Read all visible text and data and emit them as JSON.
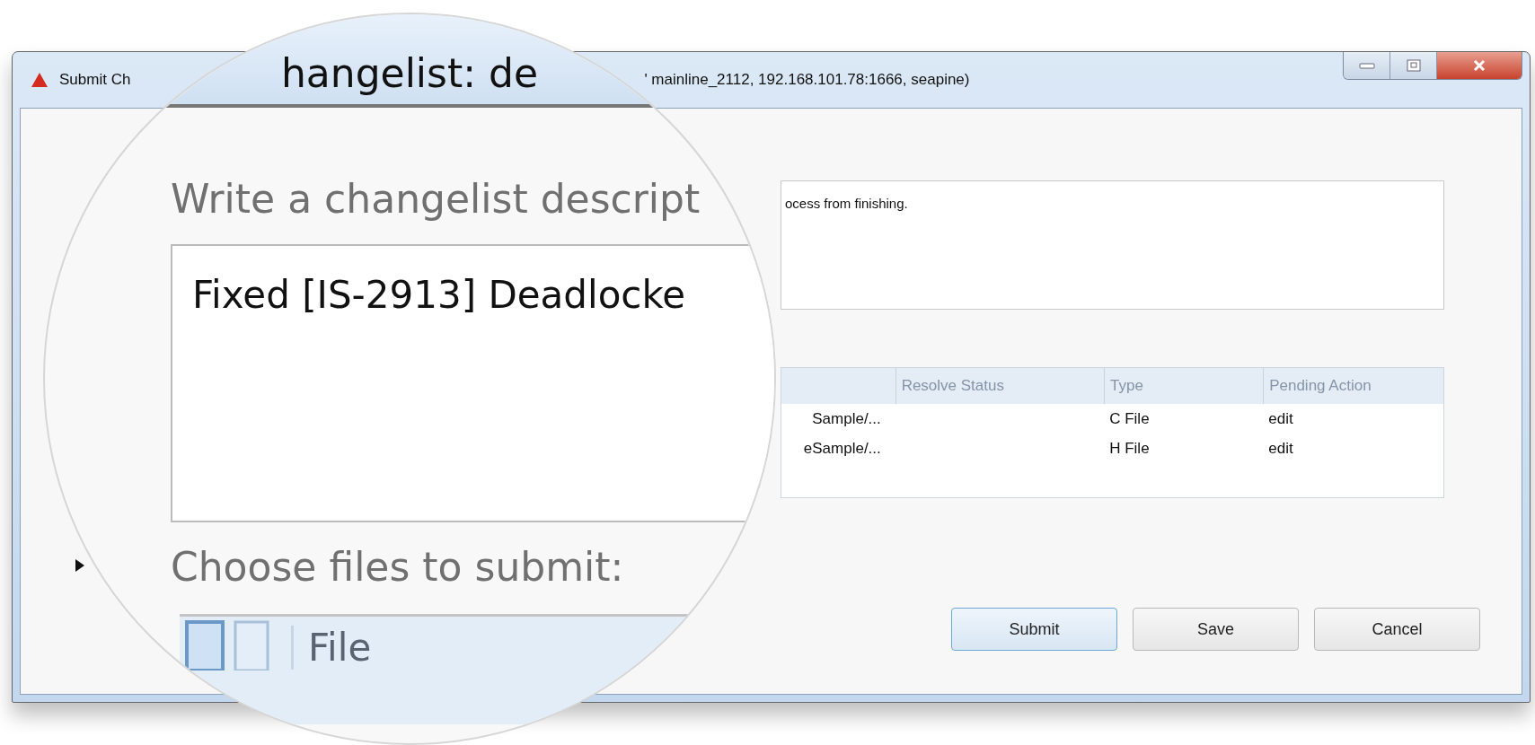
{
  "window": {
    "title_start": "Submit Ch",
    "title_end": "' mainline_2112,  192.168.101.78:1666,  seapine)"
  },
  "description": {
    "value": "ocess from finishing."
  },
  "files_table": {
    "columns": [
      "Resolve Status",
      "Type",
      "Pending Action"
    ],
    "rows": [
      {
        "file": "Sample/...",
        "type": "C File",
        "pending_action": "edit"
      },
      {
        "file": "eSample/...",
        "type": "H File",
        "pending_action": "edit"
      }
    ]
  },
  "expander": {
    "expanded": false
  },
  "buttons": [
    {
      "label": "Submit",
      "default": true
    },
    {
      "label": "Save",
      "default": false
    },
    {
      "label": "Cancel",
      "default": false
    }
  ],
  "magnifier": {
    "window_title": "hangelist: de",
    "description_label": "Write a changelist descript",
    "description_value": "Fixed [IS-2913] Deadlocke",
    "files_label": "Choose files to submit:",
    "file_column": "File"
  }
}
